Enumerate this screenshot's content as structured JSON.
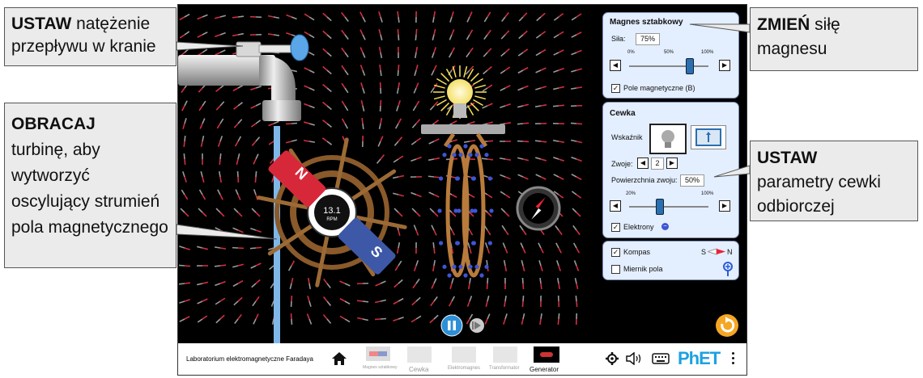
{
  "callouts": {
    "faucet": {
      "bold": "USTAW",
      "rest": " natężenie przepływu w kranie"
    },
    "turbine": {
      "bold": "OBRACAJ",
      "rest": "turbinę, aby wytworzyć oscylujący strumień pola magnetycznego"
    },
    "magnet": {
      "bold": "ZMIEŃ",
      "rest": " siłę magnesu"
    },
    "coil": {
      "bold": "USTAW",
      "rest": "parametry cewki odbiorczej"
    }
  },
  "magnet_panel": {
    "title": "Magnes sztabkowy",
    "strength_label": "Siła:",
    "strength_value": "75%",
    "ticks": [
      "0%",
      "50%",
      "100%"
    ],
    "strength_fraction": 0.75,
    "field_checkbox": "Pole magnetyczne (B)",
    "field_checked": true
  },
  "coil_panel": {
    "title": "Cewka",
    "indicator_label": "Wskaźnik",
    "loops_label": "Zwoje:",
    "loops_value": "2",
    "area_label": "Powierzchnia zwoju:",
    "area_value": "50%",
    "ticks": [
      "20%",
      "100%"
    ],
    "area_fraction": 0.5,
    "electrons_label": "Elektrony",
    "electrons_checked": true
  },
  "tools_panel": {
    "compass_label": "Kompas",
    "compass_checked": true,
    "compass_s": "S",
    "compass_n": "N",
    "fieldmeter_label": "Miernik pola",
    "fieldmeter_checked": false
  },
  "turbine": {
    "rpm_value": "13.1",
    "rpm_unit": "RPM"
  },
  "magnet_poles": {
    "north": "N",
    "south": "S"
  },
  "navbar": {
    "app_title": "Laboratorium elektromagnetyczne Faradaya",
    "screens": [
      {
        "label": "Magnes sztabkowy",
        "active": false
      },
      {
        "label": "Cewka",
        "active": false
      },
      {
        "label": "Elektromagnes",
        "active": false
      },
      {
        "label": "Transformator",
        "active": false
      },
      {
        "label": "Generator",
        "active": true
      }
    ],
    "brand": "PhET"
  },
  "colors": {
    "panel_bg": "#e3eeff",
    "accent_orange": "#f5a623",
    "play_blue": "#2d8fd6"
  },
  "icons": [
    "home-icon",
    "gear-icon",
    "speaker-icon",
    "keyboard-icon",
    "kebab-menu-icon",
    "reset-icon",
    "pause-icon",
    "step-icon",
    "bulb-icon",
    "voltmeter-icon",
    "compass-icon",
    "field-meter-icon"
  ]
}
